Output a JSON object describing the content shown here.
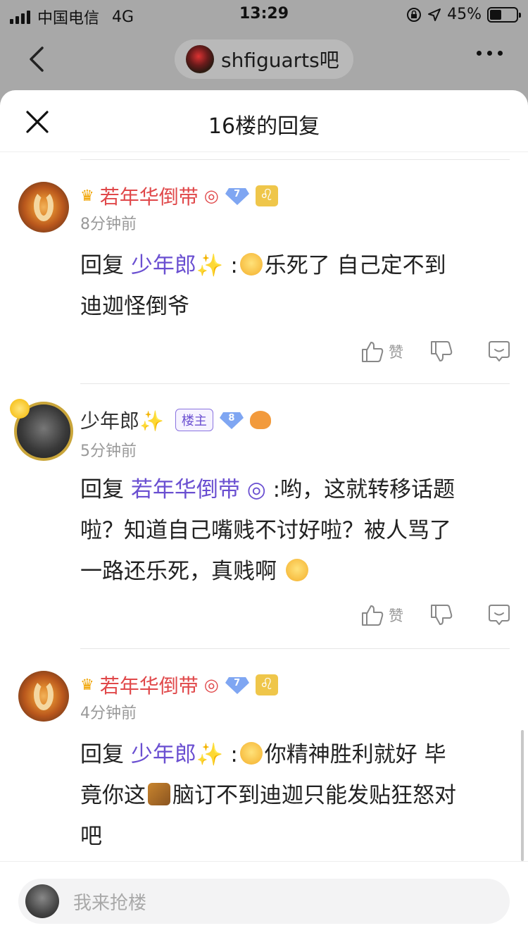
{
  "status_bar": {
    "carrier": "中国电信",
    "network": "4G",
    "time": "13:29",
    "battery_percent": "45%",
    "battery_level": 0.45
  },
  "nav": {
    "forum_name": "shfiguarts吧"
  },
  "sheet": {
    "title": "16楼的回复"
  },
  "comments": [
    {
      "username": "若年华倒带",
      "level": "7",
      "zodiac": "♌",
      "time_ago": "8分钟前",
      "reply_prefix": "回复",
      "mention": "少年郎✨",
      "text_a": "乐死了 自己定不到",
      "text_b": "迪迦怪倒爷",
      "like_label": "赞"
    },
    {
      "username": "少年郎✨",
      "host_badge": "楼主",
      "level": "8",
      "time_ago": "5分钟前",
      "reply_prefix": "回复",
      "mention": "若年华倒带 ◎",
      "text_a": ":哟，这就转移话题",
      "text_b": "啦？知道自己嘴贱不讨好啦？被人骂了",
      "text_c": "一路还乐死，真贱啊",
      "like_label": "赞"
    },
    {
      "username": "若年华倒带",
      "level": "7",
      "zodiac": "♌",
      "time_ago": "4分钟前",
      "reply_prefix": "回复",
      "mention": "少年郎✨",
      "text_a": "你精神胜利就好 毕",
      "text_b": "竟你这",
      "text_c": "脑订不到迪迦只能发贴狂怒对",
      "text_d": "吧"
    }
  ],
  "input": {
    "placeholder": "我来抢楼"
  },
  "icons": {
    "close": "close-icon",
    "back": "chevron-left-icon",
    "more": "more-icon",
    "like": "thumbs-up-icon",
    "dislike": "thumbs-down-icon",
    "reply": "comment-icon"
  }
}
